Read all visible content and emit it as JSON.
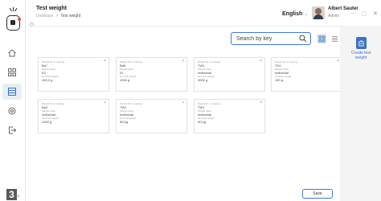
{
  "app": {
    "title": "Test weight",
    "breadcrumb": {
      "root": "Database",
      "separator": ">",
      "current": "Test weight"
    }
  },
  "header": {
    "language": "English",
    "user": {
      "name": "Albert Sauter",
      "role": "Admin"
    }
  },
  "rail": {
    "items": [
      {
        "icon": "home-icon"
      },
      {
        "icon": "apps-grid-icon"
      },
      {
        "icon": "database-icon",
        "active": true
      },
      {
        "icon": "settings-icon"
      },
      {
        "icon": "logout-icon"
      }
    ],
    "badge": "3"
  },
  "toolbar": {
    "search_placeholder": "Search by key",
    "grid_view_icon": "grid-view-icon",
    "list_view_icon": "list-view-icon"
  },
  "labels": {
    "weight_id": "Weight ID or marking",
    "class": "Weight class",
    "nominal": "Nominal weight"
  },
  "cards": [
    {
      "id": "Ba7",
      "class": "E2",
      "nominal": "100,0 g"
    },
    {
      "id": "Ba6",
      "class": "E1",
      "nominal": "1000 g"
    },
    {
      "id": "TW1",
      "class": "Individual",
      "nominal": "3000 g"
    },
    {
      "id": "TK4",
      "class": "Individual",
      "nominal": "150 g"
    },
    {
      "id": "Ba3",
      "class": "Individual",
      "nominal": "1000 g"
    },
    {
      "id": "TW1",
      "class": "Individual",
      "nominal": "50,0g"
    },
    {
      "id": "TW1",
      "class": "Individual",
      "nominal": "50,0g"
    }
  ],
  "footer": {
    "save_label": "Save"
  },
  "actions": {
    "create_label": "Create test weight"
  },
  "colors": {
    "accent": "#3b73c4",
    "outline": "#3a7bd5",
    "panel": "#f4f4f4"
  }
}
